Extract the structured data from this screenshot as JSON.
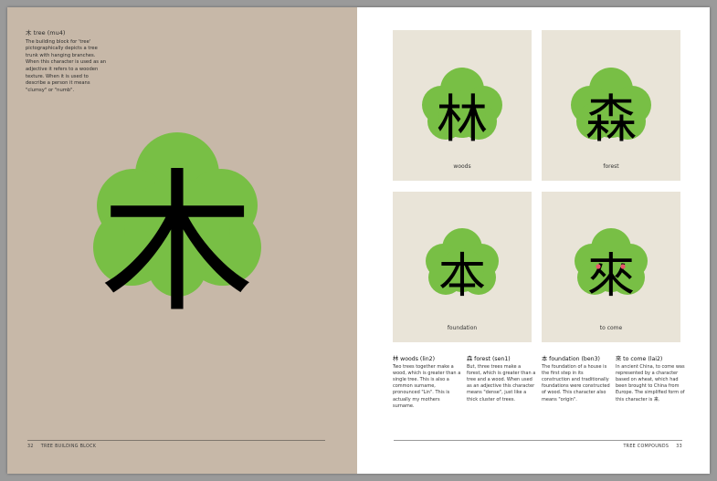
{
  "left_page": {
    "intro": {
      "char": "木",
      "heading": "tree (mu4)",
      "body": "The building block for 'tree' pictographically depicts a tree trunk with hanging branches. When this character is used as an adjective it refers to a wooden texture. When it is used to describe a person it means \"clumsy\" or \"numb\"."
    },
    "big_char": "木",
    "footer": {
      "page_number": "32",
      "section": "TREE BUILDING BLOCK"
    }
  },
  "right_page": {
    "cards": [
      {
        "char": "林",
        "label": "woods"
      },
      {
        "char": "森",
        "label": "forest"
      },
      {
        "char": "本",
        "label": "foundation"
      },
      {
        "char": "來",
        "label": "to come"
      }
    ],
    "descriptions": [
      {
        "char": "林",
        "heading": "woods (lin2)",
        "body": "Two trees together make a wood, which is greater than a single tree. This is also a common surname, pronounced \"Lin\". This is actually my mothers surname."
      },
      {
        "char": "森",
        "heading": "forest (sen1)",
        "body": "But, three trees make a forest, which is greater than a tree and a wood. When used as an adjective this character means \"dense\", just like a thick cluster of trees."
      },
      {
        "char": "本",
        "heading": "foundation (ben3)",
        "body": "The foundation of a house is the first step in its construction and traditionally foundations were constructed of wood. This character also means \"origin\"."
      },
      {
        "char": "來",
        "heading": "to come (lai2)",
        "body": "In ancient China, to come was represented by a character based on wheat, which had been brought to China from Europe. The simplified form of this character is 来."
      }
    ],
    "footer": {
      "section": "TREE COMPOUNDS",
      "page_number": "33"
    }
  },
  "colors": {
    "tree_green": "#78bf45",
    "left_page_bg": "#c7b8a8",
    "card_bg": "#e9e4d8",
    "wheat_dot": "#e8556a"
  }
}
